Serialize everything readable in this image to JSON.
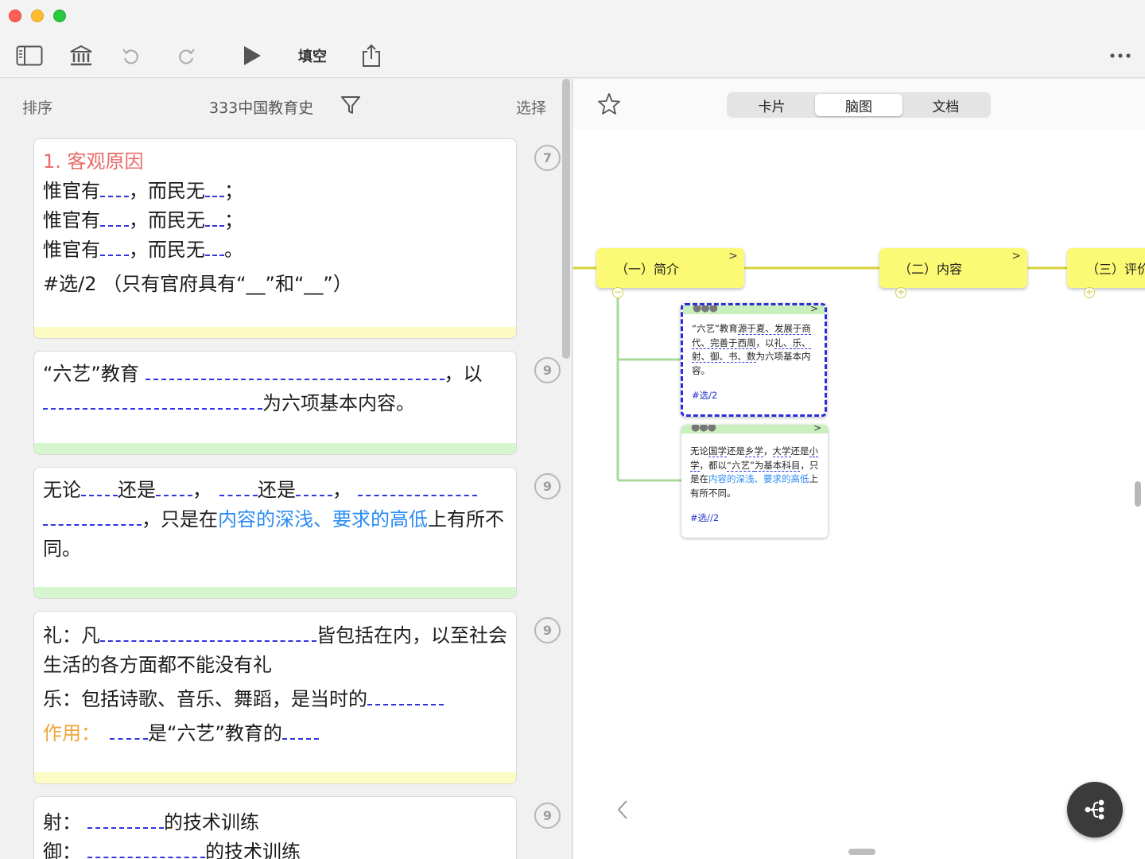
{
  "toolbar": {
    "fill_blank_label": "填空",
    "icons": [
      "sidebar-icon",
      "library-icon",
      "undo-icon",
      "redo-icon",
      "play-icon",
      "share-icon",
      "more-icon"
    ]
  },
  "list": {
    "sort_label": "排序",
    "deck_title": "333中国教育史",
    "select_label": "选择"
  },
  "cards": [
    {
      "badge": "7",
      "footer": "yellow",
      "title": "1.  客观原因",
      "lines": [
        {
          "a": "惟官有",
          "b": "，而民无",
          "c": "；"
        },
        {
          "a": "惟官有",
          "b": "，而民无",
          "c": "；"
        },
        {
          "a": "惟官有",
          "b": "，而民无",
          "c": "。"
        }
      ],
      "note": "#选/2 （只有官府具有“__”和“__”）"
    },
    {
      "badge": "9",
      "footer": "green",
      "p1": "“六艺”教育",
      "p2": "，以",
      "p3": "为六项基本内容。"
    },
    {
      "badge": "9",
      "footer": "green",
      "p1": "无论",
      "p2": "还是",
      "p3": "，",
      "p4": "还是",
      "p5": "，",
      "p6": "，只是在",
      "p7": "内容的深浅、要求的高低",
      "p8": "上有所不同。"
    },
    {
      "badge": "9",
      "footer": "yellow",
      "l1a": "礼：凡",
      "l1b": "皆包括在内，以至社会生活的各方面都不能没有礼",
      "l2": "乐：包括诗歌、音乐、舞蹈，是当时的",
      "l3a": "作用：",
      "l3b": "是“六艺”教育的"
    },
    {
      "badge": "9",
      "l1a": "射：",
      "l1b": "的技术训练",
      "l2a": "御：",
      "l2b": "的技术训练"
    }
  ],
  "view_tabs": [
    "卡片",
    "脑图",
    "文档"
  ],
  "active_tab": "脑图",
  "mindmap": {
    "nodes": [
      "（一）简介",
      "（二）内容",
      "（三）评价"
    ],
    "card1": {
      "t1": "“六艺”教育",
      "t2": "源于夏、发展于商代、完善于西周",
      "t3": "，以",
      "t4": "礼、乐、射、御、书、数",
      "t5": "为六项基本内容。",
      "tag": "#选/2"
    },
    "card2": {
      "t1": "无论",
      "t2": "国学",
      "t3": "还是",
      "t4": "乡学",
      "t5": "，",
      "t6": "大学",
      "t7": "还是",
      "t8": "小学",
      "t9": "，都以",
      "t10": "“六艺”",
      "t11": "为基本科目",
      "t12": "，只是在",
      "t13": "内容的深浅、要求的高低",
      "t14": "上有所不同。",
      "tag": "#选//2"
    }
  },
  "colors": {
    "node_yellow": "#fcfa74",
    "blank_blue": "#2f35e0",
    "highlight_blue": "#2a8bf2",
    "title_red": "#ea6b6b",
    "label_orange": "#efa43a",
    "footer_green": "#d6f6cf",
    "footer_yellow": "#fdfbc4"
  }
}
